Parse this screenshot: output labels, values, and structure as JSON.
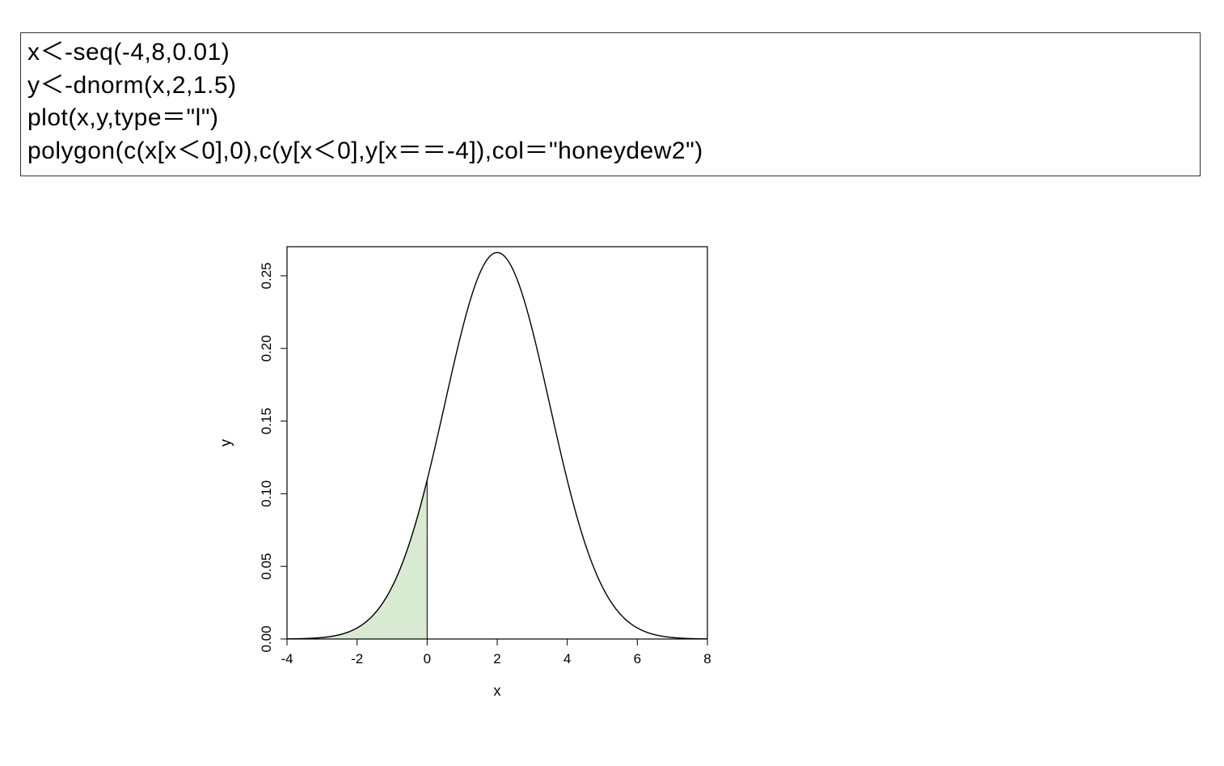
{
  "code": {
    "line1": "x＜-seq(-4,8,0.01)",
    "line2": "y＜-dnorm(x,2,1.5)",
    "line3": "plot(x,y,type＝\"l\")",
    "line4": "polygon(c(x[x＜0],0),c(y[x＜0],y[x＝＝-4]),col＝\"honeydew2\")"
  },
  "chart_data": {
    "type": "line",
    "xlabel": "x",
    "ylabel": "y",
    "xlim": [
      -4,
      8
    ],
    "ylim": [
      0,
      0.27
    ],
    "x_ticks": [
      -4,
      -2,
      0,
      2,
      4,
      6,
      8
    ],
    "y_ticks": [
      0.0,
      0.05,
      0.1,
      0.15,
      0.2,
      0.25
    ],
    "distribution": {
      "type": "normal",
      "mean": 2,
      "sd": 1.5
    },
    "shaded_region": {
      "xmin": -4,
      "xmax": 0,
      "fill": "#d9ead3"
    },
    "colors": {
      "line": "#000000",
      "fill": "#d9ead3",
      "box": "#000000"
    }
  }
}
